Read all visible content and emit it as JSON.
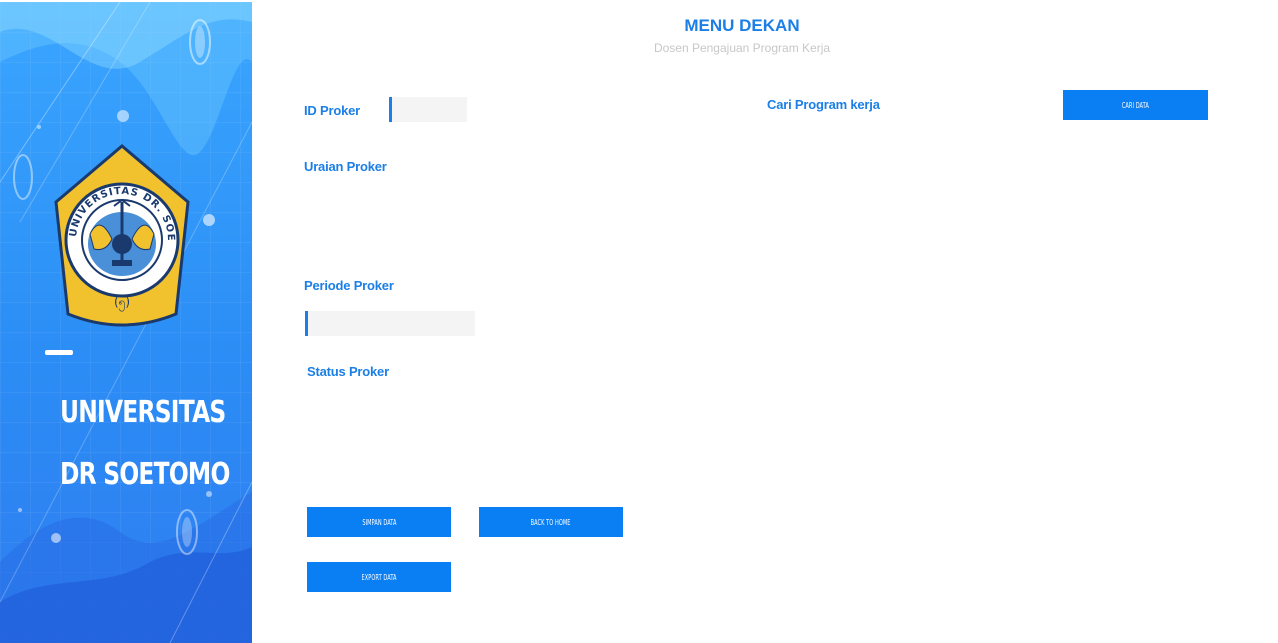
{
  "sidebar": {
    "brand_line1": "UNIVERSITAS",
    "brand_line2": "DR SOETOMO",
    "logo_text_top": "UNIVERSITAS DR. SOETOMO",
    "accent": "#2b8df5"
  },
  "header": {
    "title": "MENU DEKAN",
    "subtitle": "Dosen Pengajuan Program Kerja"
  },
  "form": {
    "id_label": "ID Proker",
    "id_value": "",
    "search_label": "Cari Program kerja",
    "search_button": "CARI DATA",
    "uraian_label": "Uraian Proker",
    "periode_label": "Periode Proker",
    "periode_value": "",
    "status_label": "Status Proker"
  },
  "actions": {
    "save": "SIMPAN DATA",
    "back": "BACK TO HOME",
    "export": "EXPORT DATA"
  },
  "colors": {
    "primary": "#0a7ef3",
    "label": "#1b7fe6",
    "subtitle": "#c7c7c7"
  }
}
